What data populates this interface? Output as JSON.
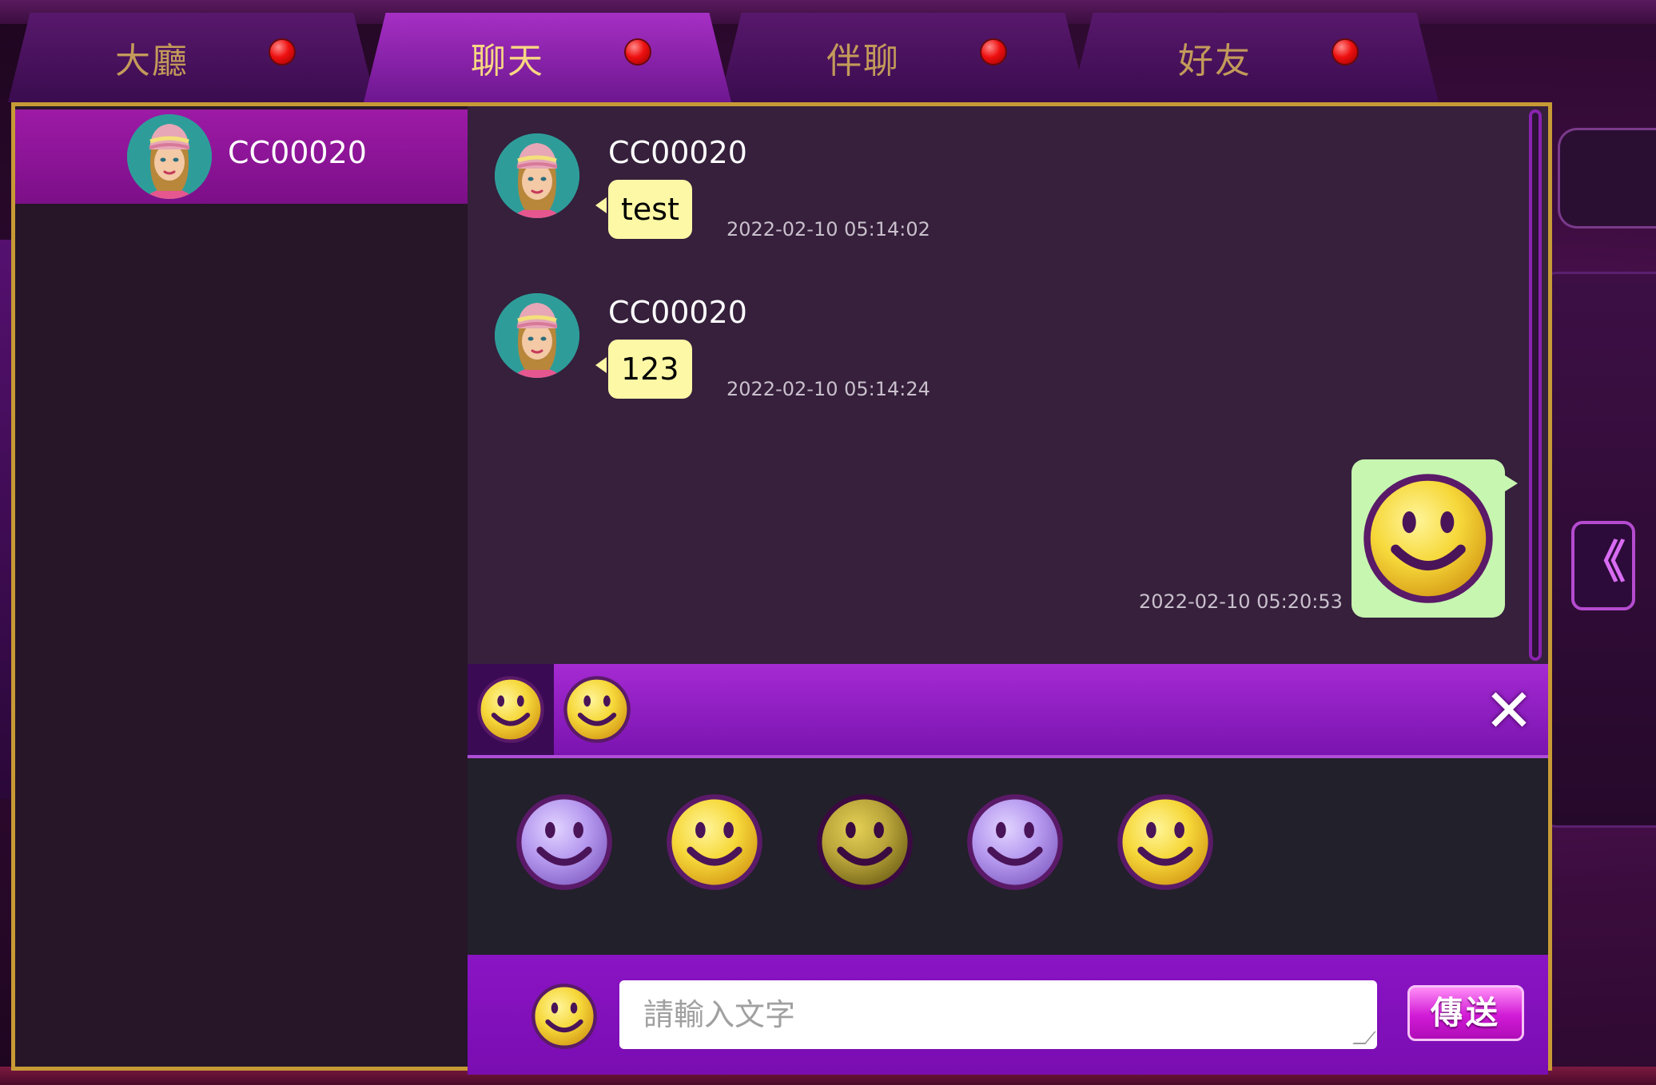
{
  "tabs": [
    {
      "label": "大廳",
      "active": false
    },
    {
      "label": "聊天",
      "active": true
    },
    {
      "label": "伴聊",
      "active": false
    },
    {
      "label": "好友",
      "active": false
    }
  ],
  "sidebar": {
    "contacts": [
      {
        "name": "CC00020",
        "selected": true
      }
    ]
  },
  "messages": [
    {
      "sender": "CC00020",
      "text": "test",
      "time": "2022-02-10 05:14:02",
      "direction": "in"
    },
    {
      "sender": "CC00020",
      "text": "123",
      "time": "2022-02-10 05:14:24",
      "direction": "in"
    },
    {
      "content": "smiley-emoji",
      "time": "2022-02-10 05:20:53",
      "direction": "out"
    }
  ],
  "emoji_panel": {
    "tabs": [
      "smiley-tab-1",
      "smiley-tab-2"
    ],
    "selected_tab": 0,
    "emojis": [
      {
        "icon": "smiley-face-icon",
        "color": "#b79bf0"
      },
      {
        "icon": "smiley-face-icon",
        "color": "#f7e35c"
      },
      {
        "icon": "smiley-face-icon",
        "color": "#b9a53a"
      },
      {
        "icon": "smiley-face-icon",
        "color": "#b79bf0"
      },
      {
        "icon": "smiley-face-icon",
        "color": "#f7e35c"
      }
    ]
  },
  "input": {
    "placeholder": "請輸入文字",
    "value": ""
  },
  "send_label": "傳送",
  "collapse_label": "《",
  "colors": {
    "accent": "#8a14c4",
    "gold_border": "#c79a35",
    "notify_dot": "#ee1010",
    "incoming_bubble": "#fcf8a6",
    "outgoing_bubble": "#c7f6b0"
  }
}
